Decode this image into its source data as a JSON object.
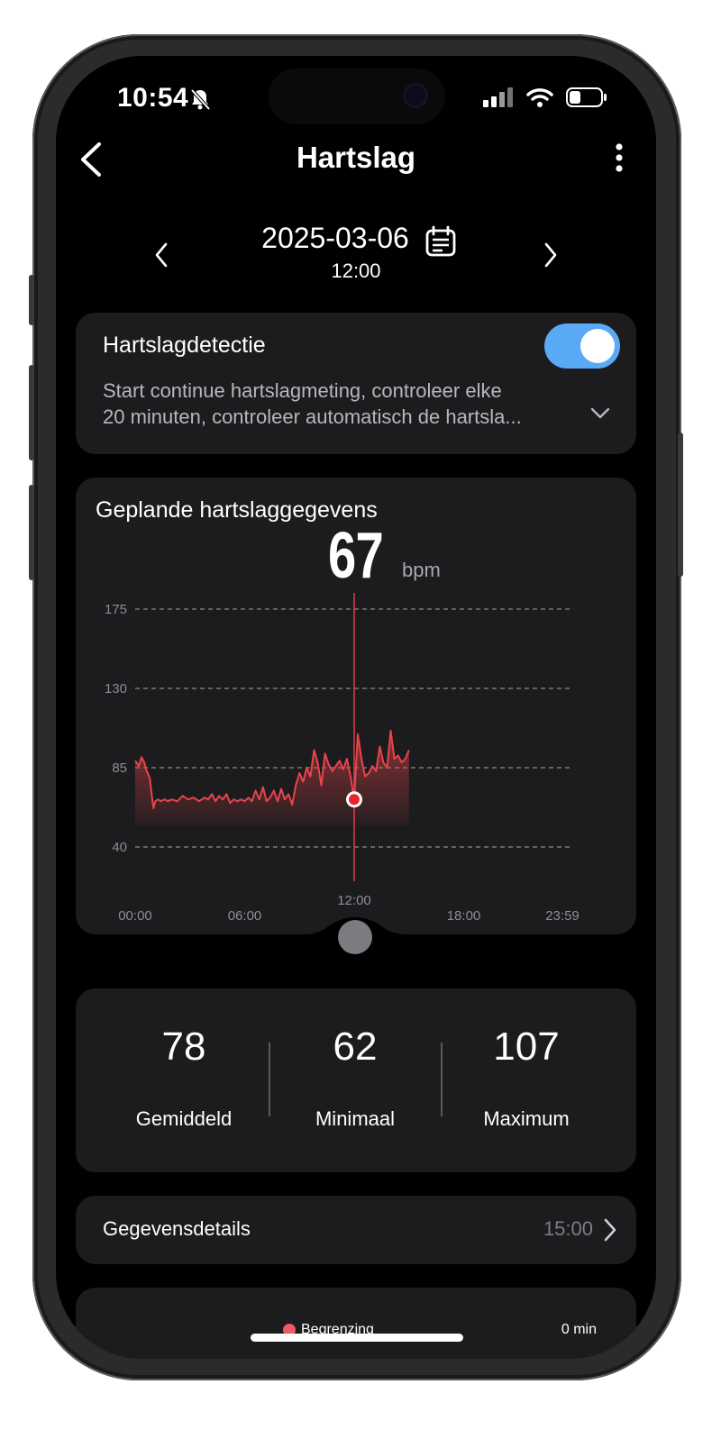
{
  "status": {
    "time": "10:54"
  },
  "nav": {
    "title": "Hartslag"
  },
  "date": {
    "main": "2025-03-06",
    "sub": "12:00"
  },
  "detection": {
    "title": "Hartslagdetectie",
    "enabled": true,
    "desc_line1": "Start continue hartslagmeting, controleer elke",
    "desc_line2": "20 minuten, controleer automatisch de hartsla..."
  },
  "chart_card": {
    "title": "Geplande hartslaggegevens",
    "value": "67",
    "unit": "bpm"
  },
  "chart_data": {
    "type": "area",
    "title": "Geplande hartslaggegevens",
    "yticks": [
      175,
      130,
      85,
      40
    ],
    "ylim": [
      40,
      175
    ],
    "xticks": [
      "00:00",
      "06:00",
      "12:00",
      "18:00",
      "23:59"
    ],
    "xlim_hours": [
      0,
      24
    ],
    "grid": true,
    "selected": {
      "x_hour": 12.0,
      "y": 67,
      "label": "12:00"
    },
    "color": "#e8444b",
    "series": [
      {
        "x": [
          0.0,
          0.2,
          0.35,
          0.5,
          0.6,
          0.8,
          0.9,
          1.0,
          1.1,
          1.25,
          1.4,
          1.6,
          1.8,
          2.0,
          2.3,
          2.6,
          2.9,
          3.2,
          3.5,
          3.8,
          4.0,
          4.2,
          4.4,
          4.6,
          4.8,
          5.0,
          5.2,
          5.4,
          5.6,
          5.8,
          6.0,
          6.2,
          6.4,
          6.6,
          6.8,
          7.0,
          7.2,
          7.4,
          7.6,
          7.8,
          8.0,
          8.2,
          8.4,
          8.6,
          8.8,
          9.0,
          9.2,
          9.4,
          9.6,
          9.8,
          10.0,
          10.2,
          10.4,
          10.6,
          10.8,
          11.0,
          11.2,
          11.4,
          11.6,
          11.8,
          12.0,
          12.2,
          12.4,
          12.6,
          12.8,
          13.0,
          13.2,
          13.4,
          13.6,
          13.8,
          14.0,
          14.2,
          14.4,
          14.6,
          14.8,
          15.0
        ],
        "y": [
          89,
          86,
          91,
          88,
          84,
          79,
          70,
          62,
          66,
          67,
          66,
          67,
          66,
          67,
          66,
          69,
          67,
          68,
          66,
          68,
          67,
          70,
          66,
          69,
          67,
          70,
          65,
          67,
          66,
          67,
          66,
          68,
          66,
          72,
          67,
          74,
          66,
          68,
          72,
          66,
          73,
          67,
          70,
          64,
          75,
          82,
          77,
          85,
          80,
          95,
          88,
          75,
          93,
          87,
          83,
          86,
          89,
          84,
          90,
          80,
          67,
          104,
          90,
          80,
          82,
          86,
          83,
          97,
          88,
          85,
          106,
          90,
          92,
          88,
          90,
          95
        ]
      }
    ]
  },
  "stats": {
    "avg": {
      "value": "78",
      "label": "Gemiddeld"
    },
    "min": {
      "value": "62",
      "label": "Minimaal"
    },
    "max": {
      "value": "107",
      "label": "Maximum"
    }
  },
  "details": {
    "label": "Gegevensdetails",
    "value": "15:00"
  },
  "zones": {
    "legend_label": "Begrenzing",
    "value": "0 min",
    "legend_color": "#f05a66"
  },
  "icons": [
    "bell-slash-icon",
    "cellular-icon",
    "wifi-icon",
    "battery-icon",
    "back-chevron-icon",
    "more-vertical-icon",
    "chevron-left-icon",
    "chevron-right-icon",
    "calendar-icon",
    "chevron-down-icon"
  ]
}
